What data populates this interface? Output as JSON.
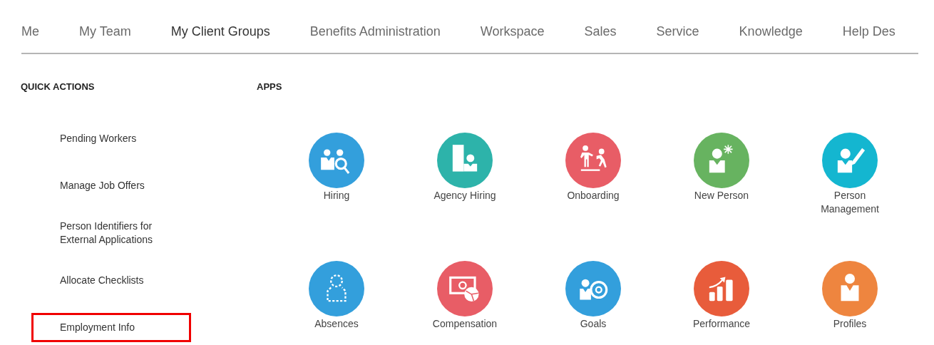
{
  "tabs": [
    {
      "label": "Me",
      "selected": false
    },
    {
      "label": "My Team",
      "selected": false
    },
    {
      "label": "My Client Groups",
      "selected": true
    },
    {
      "label": "Benefits Administration",
      "selected": false
    },
    {
      "label": "Workspace",
      "selected": false
    },
    {
      "label": "Sales",
      "selected": false
    },
    {
      "label": "Service",
      "selected": false
    },
    {
      "label": "Knowledge",
      "selected": false
    },
    {
      "label": "Help Des",
      "selected": false
    }
  ],
  "quick_actions": {
    "heading": "QUICK ACTIONS",
    "items": [
      {
        "label": "Pending Workers",
        "highlighted": false
      },
      {
        "label": "Manage Job Offers",
        "highlighted": false
      },
      {
        "label": "Person Identifiers for External Applications",
        "highlighted": false
      },
      {
        "label": "Allocate Checklists",
        "highlighted": false
      },
      {
        "label": "Employment Info",
        "highlighted": true
      }
    ]
  },
  "apps": {
    "heading": "APPS",
    "items": [
      {
        "label": "Hiring",
        "kind": "hiring",
        "color": "#339fdc"
      },
      {
        "label": "Agency Hiring",
        "kind": "agency",
        "color": "#2db3aa"
      },
      {
        "label": "Onboarding",
        "kind": "onboarding",
        "color": "#e85d66"
      },
      {
        "label": "New Person",
        "kind": "newperson",
        "color": "#67b360"
      },
      {
        "label": "Person Management",
        "kind": "personedit",
        "color": "#14b6d0"
      },
      {
        "label": "Absences",
        "kind": "absences",
        "color": "#339fdc"
      },
      {
        "label": "Compensation",
        "kind": "compensation",
        "color": "#e85d66"
      },
      {
        "label": "Goals",
        "kind": "goals",
        "color": "#339fdc"
      },
      {
        "label": "Performance",
        "kind": "performance",
        "color": "#e85c3b"
      },
      {
        "label": "Profiles",
        "kind": "profiles",
        "color": "#ee853f"
      }
    ]
  }
}
